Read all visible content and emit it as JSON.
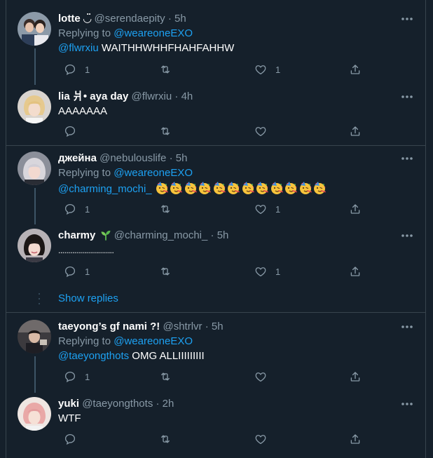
{
  "colors": {
    "background": "#15202b",
    "border": "#38444d",
    "text": "#ffffff",
    "muted": "#8899a6",
    "accent": "#1da1f2",
    "thread_line": "#3d5466"
  },
  "tweets": [
    {
      "name": "lotte ◡̈",
      "handle": "@serendaepity",
      "time": "5h",
      "replying_prefix": "Replying to",
      "replying_to": "@weareoneEXO",
      "mention": "@flwrxiu",
      "text": " WAITHHWHHFHAHFAHHW",
      "reply_count": "1",
      "retweet_count": "",
      "like_count": "1",
      "avatar_icon": "avatar-two-people"
    },
    {
      "name": "lia 爿• aya day",
      "handle": "@flwrxiu",
      "time": "4h",
      "text": "AAAAAAA",
      "reply_count": "",
      "retweet_count": "",
      "like_count": "",
      "avatar_icon": "avatar-blonde"
    },
    {
      "name": "джейна",
      "handle": "@nebulouslife",
      "time": "5h",
      "replying_prefix": "Replying to",
      "replying_to": "@weareoneEXO",
      "mention": "@charming_mochi_",
      "emoji_count": 12,
      "emoji_icon": "partying-face-icon",
      "reply_count": "1",
      "retweet_count": "",
      "like_count": "1",
      "avatar_icon": "avatar-silver-hair"
    },
    {
      "name": "charmy",
      "name_icon": "seedling-icon",
      "handle": "@charming_mochi_",
      "time": "5h",
      "text": "............................",
      "reply_count": "1",
      "retweet_count": "",
      "like_count": "1",
      "avatar_icon": "avatar-dark-hair"
    },
    {
      "name": "taeyong’s gf nami ?!",
      "handle": "@shtrlvr",
      "time": "5h",
      "replying_prefix": "Replying to",
      "replying_to": "@weareoneEXO",
      "mention": "@taeyongthots",
      "text": " OMG ALLIIIIIIIII",
      "reply_count": "1",
      "retweet_count": "",
      "like_count": "",
      "avatar_icon": "avatar-photo"
    },
    {
      "name": "yuki",
      "handle": "@taeyongthots",
      "time": "2h",
      "text": "WTF",
      "reply_count": "",
      "retweet_count": "",
      "like_count": "",
      "avatar_icon": "avatar-pink-hair"
    }
  ],
  "show_replies": "Show replies",
  "separator": "·"
}
